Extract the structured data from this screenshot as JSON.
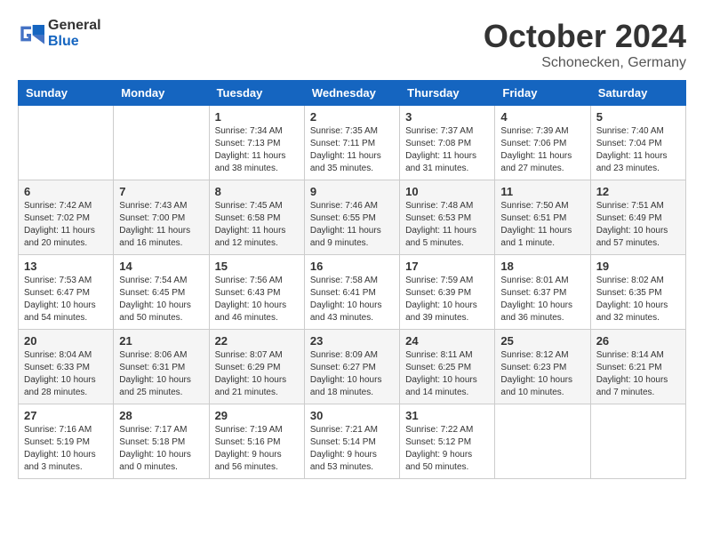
{
  "logo": {
    "general": "General",
    "blue": "Blue"
  },
  "header": {
    "month": "October 2024",
    "location": "Schonecken, Germany"
  },
  "weekdays": [
    "Sunday",
    "Monday",
    "Tuesday",
    "Wednesday",
    "Thursday",
    "Friday",
    "Saturday"
  ],
  "weeks": [
    [
      {
        "day": "",
        "info": ""
      },
      {
        "day": "",
        "info": ""
      },
      {
        "day": "1",
        "info": "Sunrise: 7:34 AM\nSunset: 7:13 PM\nDaylight: 11 hours and 38 minutes."
      },
      {
        "day": "2",
        "info": "Sunrise: 7:35 AM\nSunset: 7:11 PM\nDaylight: 11 hours and 35 minutes."
      },
      {
        "day": "3",
        "info": "Sunrise: 7:37 AM\nSunset: 7:08 PM\nDaylight: 11 hours and 31 minutes."
      },
      {
        "day": "4",
        "info": "Sunrise: 7:39 AM\nSunset: 7:06 PM\nDaylight: 11 hours and 27 minutes."
      },
      {
        "day": "5",
        "info": "Sunrise: 7:40 AM\nSunset: 7:04 PM\nDaylight: 11 hours and 23 minutes."
      }
    ],
    [
      {
        "day": "6",
        "info": "Sunrise: 7:42 AM\nSunset: 7:02 PM\nDaylight: 11 hours and 20 minutes."
      },
      {
        "day": "7",
        "info": "Sunrise: 7:43 AM\nSunset: 7:00 PM\nDaylight: 11 hours and 16 minutes."
      },
      {
        "day": "8",
        "info": "Sunrise: 7:45 AM\nSunset: 6:58 PM\nDaylight: 11 hours and 12 minutes."
      },
      {
        "day": "9",
        "info": "Sunrise: 7:46 AM\nSunset: 6:55 PM\nDaylight: 11 hours and 9 minutes."
      },
      {
        "day": "10",
        "info": "Sunrise: 7:48 AM\nSunset: 6:53 PM\nDaylight: 11 hours and 5 minutes."
      },
      {
        "day": "11",
        "info": "Sunrise: 7:50 AM\nSunset: 6:51 PM\nDaylight: 11 hours and 1 minute."
      },
      {
        "day": "12",
        "info": "Sunrise: 7:51 AM\nSunset: 6:49 PM\nDaylight: 10 hours and 57 minutes."
      }
    ],
    [
      {
        "day": "13",
        "info": "Sunrise: 7:53 AM\nSunset: 6:47 PM\nDaylight: 10 hours and 54 minutes."
      },
      {
        "day": "14",
        "info": "Sunrise: 7:54 AM\nSunset: 6:45 PM\nDaylight: 10 hours and 50 minutes."
      },
      {
        "day": "15",
        "info": "Sunrise: 7:56 AM\nSunset: 6:43 PM\nDaylight: 10 hours and 46 minutes."
      },
      {
        "day": "16",
        "info": "Sunrise: 7:58 AM\nSunset: 6:41 PM\nDaylight: 10 hours and 43 minutes."
      },
      {
        "day": "17",
        "info": "Sunrise: 7:59 AM\nSunset: 6:39 PM\nDaylight: 10 hours and 39 minutes."
      },
      {
        "day": "18",
        "info": "Sunrise: 8:01 AM\nSunset: 6:37 PM\nDaylight: 10 hours and 36 minutes."
      },
      {
        "day": "19",
        "info": "Sunrise: 8:02 AM\nSunset: 6:35 PM\nDaylight: 10 hours and 32 minutes."
      }
    ],
    [
      {
        "day": "20",
        "info": "Sunrise: 8:04 AM\nSunset: 6:33 PM\nDaylight: 10 hours and 28 minutes."
      },
      {
        "day": "21",
        "info": "Sunrise: 8:06 AM\nSunset: 6:31 PM\nDaylight: 10 hours and 25 minutes."
      },
      {
        "day": "22",
        "info": "Sunrise: 8:07 AM\nSunset: 6:29 PM\nDaylight: 10 hours and 21 minutes."
      },
      {
        "day": "23",
        "info": "Sunrise: 8:09 AM\nSunset: 6:27 PM\nDaylight: 10 hours and 18 minutes."
      },
      {
        "day": "24",
        "info": "Sunrise: 8:11 AM\nSunset: 6:25 PM\nDaylight: 10 hours and 14 minutes."
      },
      {
        "day": "25",
        "info": "Sunrise: 8:12 AM\nSunset: 6:23 PM\nDaylight: 10 hours and 10 minutes."
      },
      {
        "day": "26",
        "info": "Sunrise: 8:14 AM\nSunset: 6:21 PM\nDaylight: 10 hours and 7 minutes."
      }
    ],
    [
      {
        "day": "27",
        "info": "Sunrise: 7:16 AM\nSunset: 5:19 PM\nDaylight: 10 hours and 3 minutes."
      },
      {
        "day": "28",
        "info": "Sunrise: 7:17 AM\nSunset: 5:18 PM\nDaylight: 10 hours and 0 minutes."
      },
      {
        "day": "29",
        "info": "Sunrise: 7:19 AM\nSunset: 5:16 PM\nDaylight: 9 hours and 56 minutes."
      },
      {
        "day": "30",
        "info": "Sunrise: 7:21 AM\nSunset: 5:14 PM\nDaylight: 9 hours and 53 minutes."
      },
      {
        "day": "31",
        "info": "Sunrise: 7:22 AM\nSunset: 5:12 PM\nDaylight: 9 hours and 50 minutes."
      },
      {
        "day": "",
        "info": ""
      },
      {
        "day": "",
        "info": ""
      }
    ]
  ]
}
